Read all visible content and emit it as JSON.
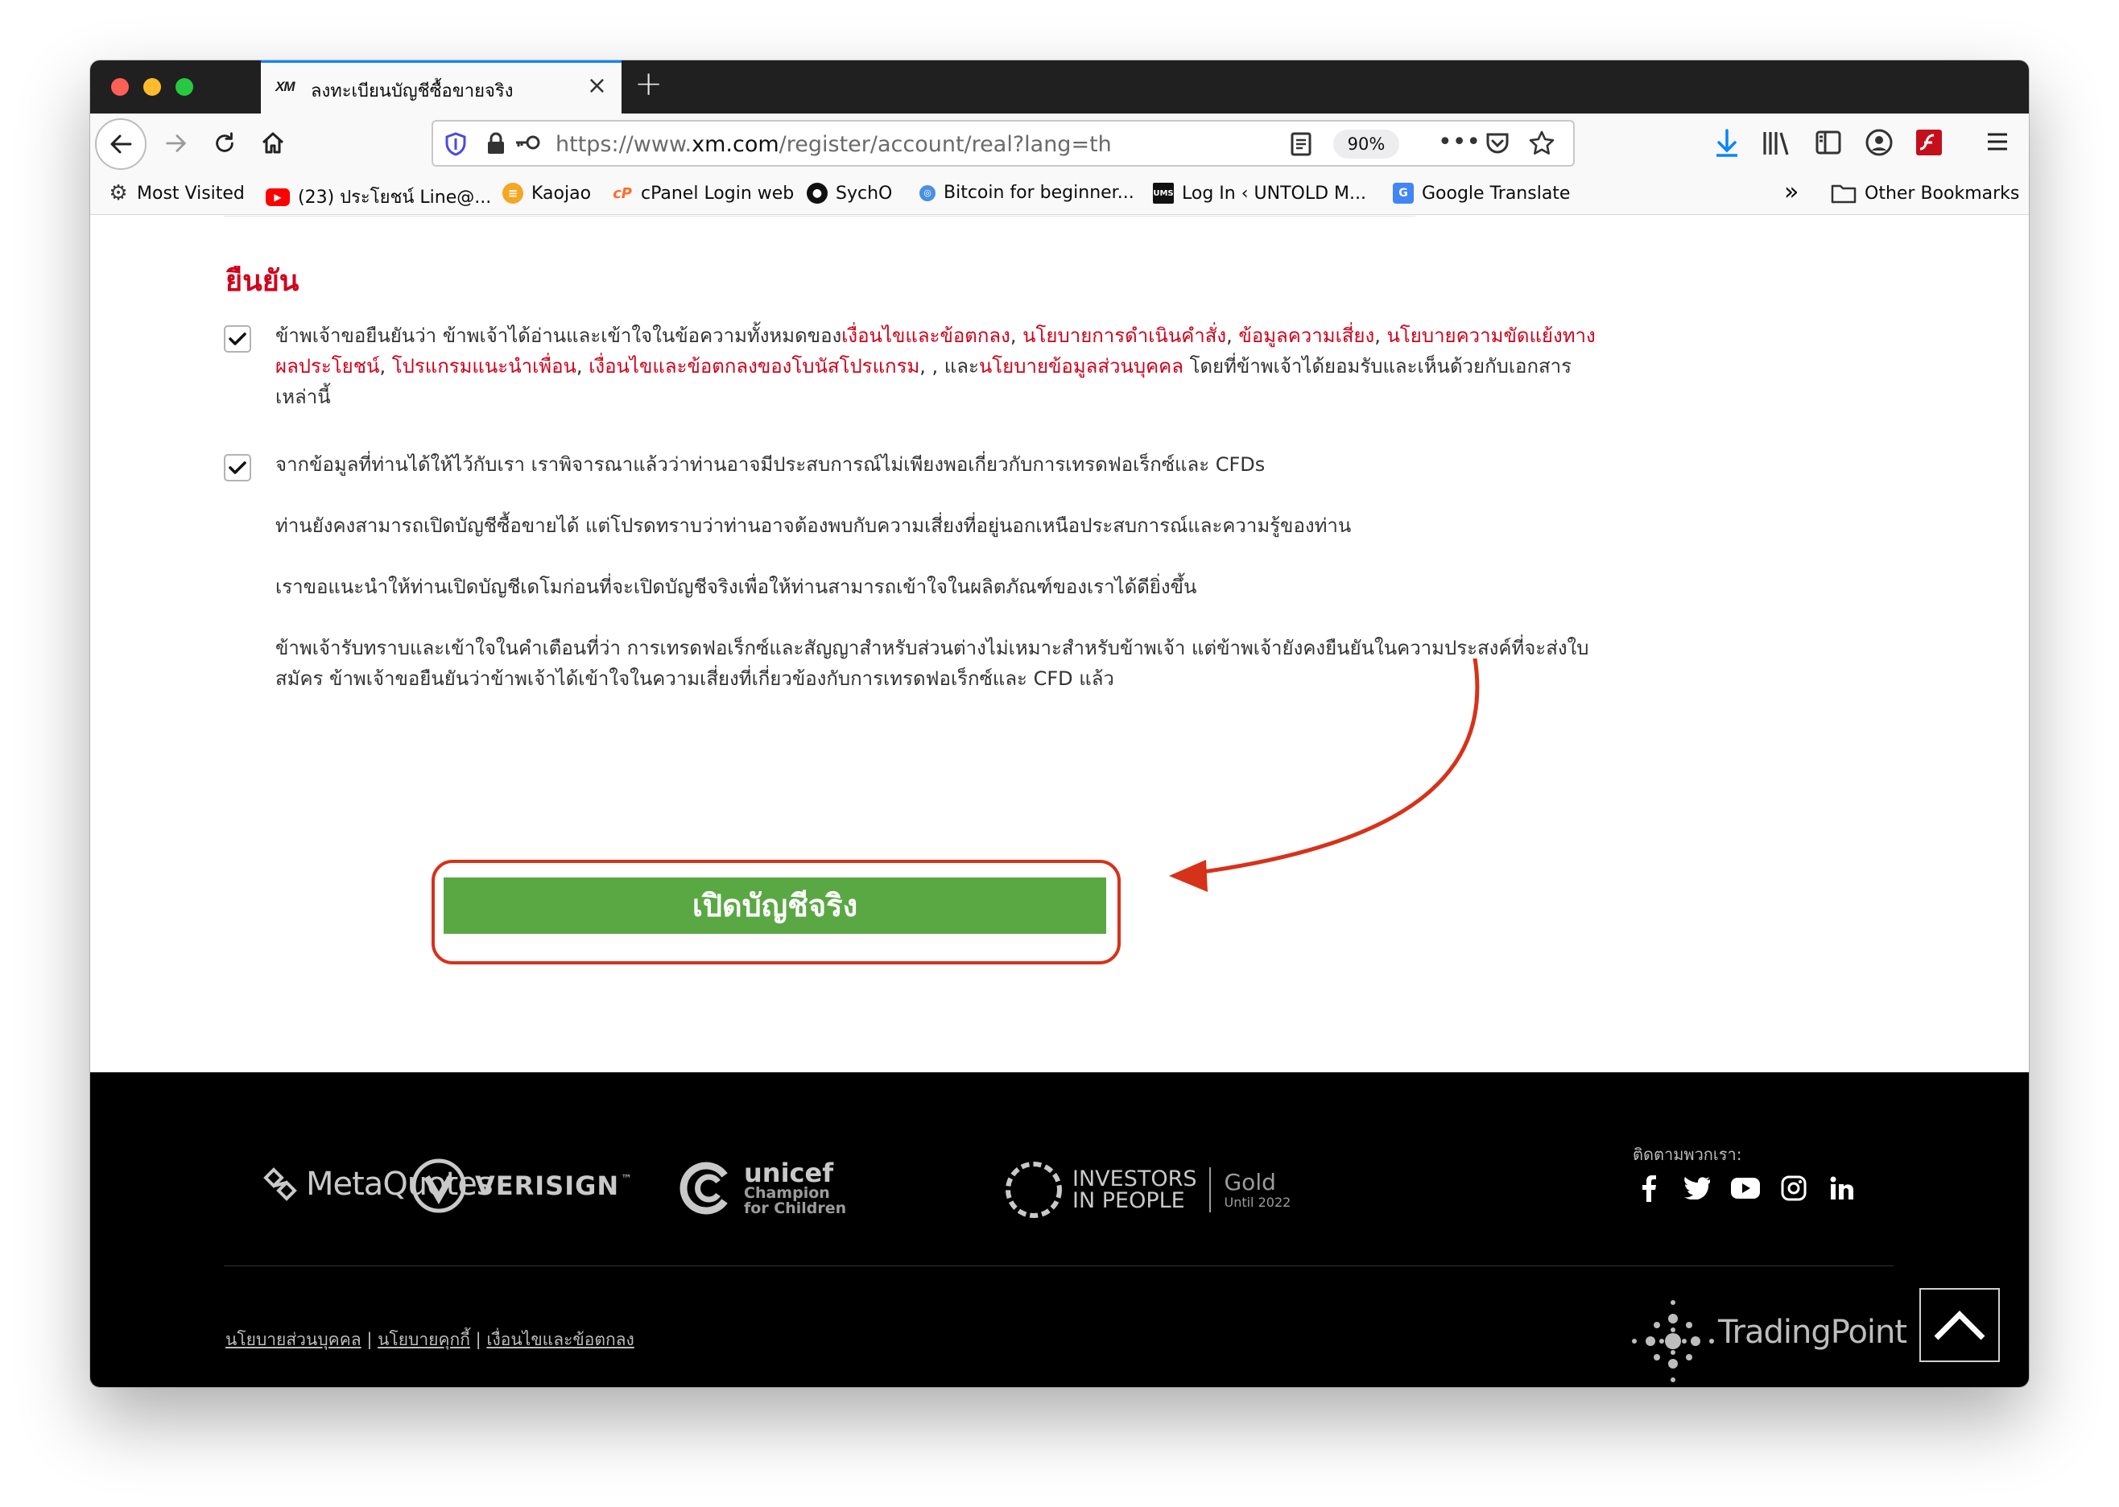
{
  "browser": {
    "tab_favicon": "XM",
    "tab_title": "ลงทะเบียนบัญชีซื้อขายจริง",
    "url_prefix": "https://www.",
    "url_domain": "xm.com",
    "url_path": "/register/account/real?lang=th",
    "zoom": "90%"
  },
  "bookmarks": {
    "items": [
      {
        "label": "Most Visited",
        "icon": "gear-icon"
      },
      {
        "label": "(23) ประโยชน์ Line@...",
        "icon": "youtube-icon"
      },
      {
        "label": "Kaojao",
        "icon": "kaojao-icon"
      },
      {
        "label": "cPanel Login web",
        "icon": "cpanel-icon"
      },
      {
        "label": "SychO",
        "icon": "github-icon"
      },
      {
        "label": "Bitcoin for beginner...",
        "icon": "globe-icon"
      },
      {
        "label": "Log In ‹ UNTOLD M...",
        "icon": "ums-icon"
      },
      {
        "label": "Google Translate",
        "icon": "translate-icon"
      }
    ],
    "other": "Other Bookmarks"
  },
  "confirm": {
    "title": "ยืนยัน",
    "terms": {
      "t1": "ข้าพเจ้าขอยืนยันว่า ข้าพเจ้าได้อ่านและเข้าใจในข้อความทั้งหมดของ",
      "l1": "เงื่อนไขและข้อตกลง",
      "s1": ", ",
      "l2": "นโยบายการดำเนินคำสั่ง",
      "s2": ", ",
      "l3": "ข้อมูลความเสี่ยง",
      "s3": ", ",
      "l4": "นโยบายความขัดแย้งทางผลประโยชน์",
      "s4": ", ",
      "l5": "โปรแกรมแนะนำเพื่อน",
      "s5": ", ",
      "l6": "เงื่อนไขและข้อตกลงของโบนัสโปรแกรม",
      "s6": ", , และ",
      "l7": "นโยบายข้อมูลส่วนบุคคล",
      "t2": " โดยที่ข้าพเจ้าได้ยอมรับและเห็นด้วยกับเอกสารเหล่านี้"
    },
    "experience": "จากข้อมูลที่ท่านได้ให้ไว้กับเรา เราพิจารณาแล้วว่าท่านอาจมีประสบการณ์ไม่เพียงพอเกี่ยวกับการเทรดฟอเร็กซ์และ CFDs",
    "para2": "ท่านยังคงสามารถเปิดบัญชีซื้อขายได้ แต่โปรดทราบว่าท่านอาจต้องพบกับความเสี่ยงที่อยู่นอกเหนือประสบการณ์และความรู้ของท่าน",
    "para3": "เราขอแนะนำให้ท่านเปิดบัญชีเดโมก่อนที่จะเปิดบัญชีจริงเพื่อให้ท่านสามารถเข้าใจในผลิตภัณฑ์ของเราได้ดียิ่งขึ้น",
    "para4": "ข้าพเจ้ารับทราบและเข้าใจในคำเตือนที่ว่า การเทรดฟอเร็กซ์และสัญญาสำหรับส่วนต่างไม่เหมาะสำหรับข้าพเจ้า แต่ข้าพเจ้ายังคงยืนยันในความประสงค์ที่จะส่งใบสมัคร ข้าพเจ้าขอยืนยันว่าข้าพเจ้าได้เข้าใจในความเสี่ยงที่เกี่ยวข้องกับการเทรดฟอเร็กซ์และ CFD แล้ว",
    "button": "เปิดบัญชีจริง"
  },
  "footer": {
    "metaquotes": "MetaQuotes",
    "verisign": "VERISIGN",
    "verisign_tm": "™",
    "unicef": "unicef",
    "unicef_sub1": "Champion",
    "unicef_sub2": "for Children",
    "iip1": "INVESTORS",
    "iip2": "IN PEOPLE",
    "iip_gold": "Gold",
    "iip_until": "Until 2022",
    "follow": "ติดตามพวกเรา:",
    "legal": {
      "l1": "นโยบายส่วนบุคคล",
      "sep": " | ",
      "l2": "นโยบายคุกกี้",
      "l3": "เงื่อนไขและข้อตกลง"
    },
    "tradingpoint": "TradingPoint"
  },
  "colors": {
    "accent_red": "#d0021b",
    "button_green": "#5aa843",
    "annotation": "#d6321a"
  }
}
